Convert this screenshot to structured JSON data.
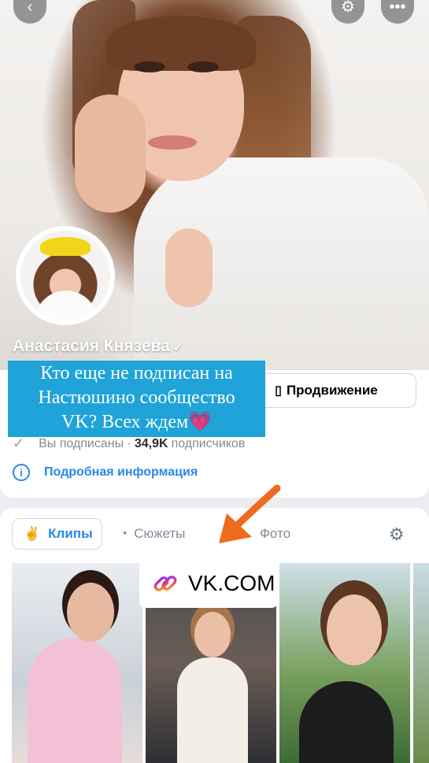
{
  "profile": {
    "name": "Анастасия Князева",
    "verified_mark": "✓",
    "promo_button": "Продвижение",
    "subscribed_label": "Вы подписаны ·",
    "subscribers_count": "34,9K",
    "subscribers_suffix": "подписчиков",
    "info_link": "Подробная информация"
  },
  "caption": {
    "line1": "Кто еще не подписан на",
    "line2": "Настюшино сообщество",
    "line3": "VK? Всех ждем💗"
  },
  "tabs": {
    "clips": "Клипы",
    "stories": "Сюжеты",
    "photo": "Фото"
  },
  "vk_badge": "VK.COM",
  "colors": {
    "accent": "#2688eb",
    "caption_bg": "#1fa3d9",
    "arrow": "#ee6a1c"
  },
  "icons": {
    "back": "chevron-left-icon",
    "settings": "gear-icon",
    "more": "more-icon",
    "promo": "megaphone-icon",
    "check": "check-icon",
    "info": "info-icon",
    "clips": "clips-icon",
    "stories": "stories-icon",
    "link": "link-icon"
  }
}
